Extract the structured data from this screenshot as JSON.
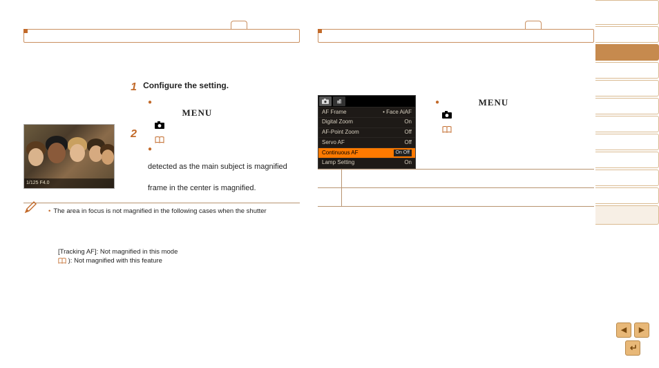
{
  "left": {
    "steps": {
      "s1": {
        "num": "1",
        "title": "Configure the setting.",
        "menu_word": "MENU",
        "body_line2_fragment": "detected as the main subject is magnified",
        "body_line3_fragment": "frame in the center is magnified."
      },
      "s2": {
        "num": "2"
      }
    },
    "photo_overlay": {
      "left": "1/125  F4.0",
      "right": ""
    },
    "note_bullet": "•",
    "note_text": "The area in focus is not magnified in the following cases when the shutter",
    "indent_notes": {
      "line1": "[Tracking AF]: Not magnified in this mode",
      "line2_suffix": "): Not magnified with this feature"
    }
  },
  "right": {
    "lcd": {
      "rows": [
        {
          "label": "AF Frame",
          "value": "• Face AiAF"
        },
        {
          "label": "Digital Zoom",
          "value": "On"
        },
        {
          "label": "AF-Point Zoom",
          "value": "Off"
        },
        {
          "label": "Servo AF",
          "value": "Off"
        },
        {
          "label": "Continuous AF",
          "value": "On  Off",
          "selected": true
        },
        {
          "label": "Lamp Setting",
          "value": "On"
        }
      ]
    },
    "step": {
      "menu_word": "MENU"
    }
  },
  "icons": {
    "camera": "camera-icon",
    "book": "book-icon",
    "pencil": "pencil-icon",
    "tools": "tools-icon",
    "prev": "◀",
    "next": "▶",
    "back": "↩"
  }
}
